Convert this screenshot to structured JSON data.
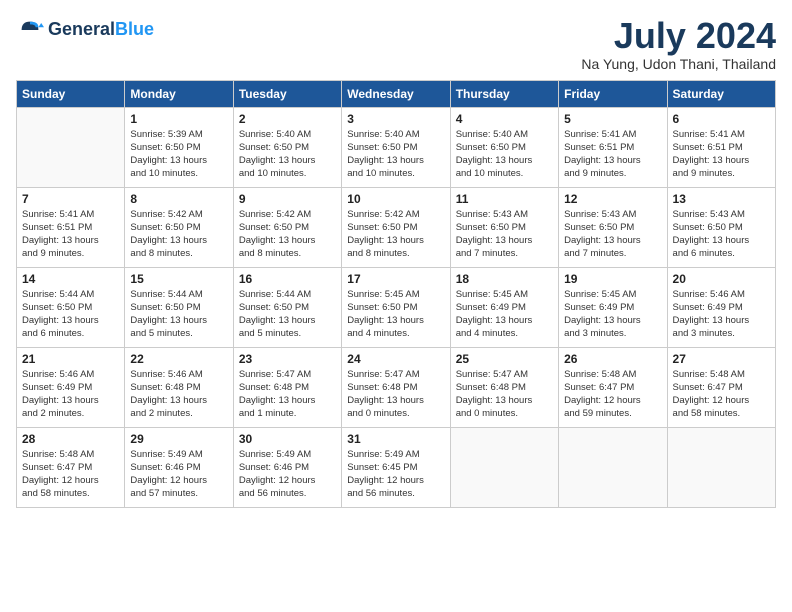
{
  "header": {
    "logo_line1": "General",
    "logo_line2": "Blue",
    "title": "July 2024",
    "subtitle": "Na Yung, Udon Thani, Thailand"
  },
  "weekdays": [
    "Sunday",
    "Monday",
    "Tuesday",
    "Wednesday",
    "Thursday",
    "Friday",
    "Saturday"
  ],
  "weeks": [
    [
      {
        "day": "",
        "info": ""
      },
      {
        "day": "1",
        "info": "Sunrise: 5:39 AM\nSunset: 6:50 PM\nDaylight: 13 hours\nand 10 minutes."
      },
      {
        "day": "2",
        "info": "Sunrise: 5:40 AM\nSunset: 6:50 PM\nDaylight: 13 hours\nand 10 minutes."
      },
      {
        "day": "3",
        "info": "Sunrise: 5:40 AM\nSunset: 6:50 PM\nDaylight: 13 hours\nand 10 minutes."
      },
      {
        "day": "4",
        "info": "Sunrise: 5:40 AM\nSunset: 6:50 PM\nDaylight: 13 hours\nand 10 minutes."
      },
      {
        "day": "5",
        "info": "Sunrise: 5:41 AM\nSunset: 6:51 PM\nDaylight: 13 hours\nand 9 minutes."
      },
      {
        "day": "6",
        "info": "Sunrise: 5:41 AM\nSunset: 6:51 PM\nDaylight: 13 hours\nand 9 minutes."
      }
    ],
    [
      {
        "day": "7",
        "info": "Sunrise: 5:41 AM\nSunset: 6:51 PM\nDaylight: 13 hours\nand 9 minutes."
      },
      {
        "day": "8",
        "info": "Sunrise: 5:42 AM\nSunset: 6:50 PM\nDaylight: 13 hours\nand 8 minutes."
      },
      {
        "day": "9",
        "info": "Sunrise: 5:42 AM\nSunset: 6:50 PM\nDaylight: 13 hours\nand 8 minutes."
      },
      {
        "day": "10",
        "info": "Sunrise: 5:42 AM\nSunset: 6:50 PM\nDaylight: 13 hours\nand 8 minutes."
      },
      {
        "day": "11",
        "info": "Sunrise: 5:43 AM\nSunset: 6:50 PM\nDaylight: 13 hours\nand 7 minutes."
      },
      {
        "day": "12",
        "info": "Sunrise: 5:43 AM\nSunset: 6:50 PM\nDaylight: 13 hours\nand 7 minutes."
      },
      {
        "day": "13",
        "info": "Sunrise: 5:43 AM\nSunset: 6:50 PM\nDaylight: 13 hours\nand 6 minutes."
      }
    ],
    [
      {
        "day": "14",
        "info": "Sunrise: 5:44 AM\nSunset: 6:50 PM\nDaylight: 13 hours\nand 6 minutes."
      },
      {
        "day": "15",
        "info": "Sunrise: 5:44 AM\nSunset: 6:50 PM\nDaylight: 13 hours\nand 5 minutes."
      },
      {
        "day": "16",
        "info": "Sunrise: 5:44 AM\nSunset: 6:50 PM\nDaylight: 13 hours\nand 5 minutes."
      },
      {
        "day": "17",
        "info": "Sunrise: 5:45 AM\nSunset: 6:50 PM\nDaylight: 13 hours\nand 4 minutes."
      },
      {
        "day": "18",
        "info": "Sunrise: 5:45 AM\nSunset: 6:49 PM\nDaylight: 13 hours\nand 4 minutes."
      },
      {
        "day": "19",
        "info": "Sunrise: 5:45 AM\nSunset: 6:49 PM\nDaylight: 13 hours\nand 3 minutes."
      },
      {
        "day": "20",
        "info": "Sunrise: 5:46 AM\nSunset: 6:49 PM\nDaylight: 13 hours\nand 3 minutes."
      }
    ],
    [
      {
        "day": "21",
        "info": "Sunrise: 5:46 AM\nSunset: 6:49 PM\nDaylight: 13 hours\nand 2 minutes."
      },
      {
        "day": "22",
        "info": "Sunrise: 5:46 AM\nSunset: 6:48 PM\nDaylight: 13 hours\nand 2 minutes."
      },
      {
        "day": "23",
        "info": "Sunrise: 5:47 AM\nSunset: 6:48 PM\nDaylight: 13 hours\nand 1 minute."
      },
      {
        "day": "24",
        "info": "Sunrise: 5:47 AM\nSunset: 6:48 PM\nDaylight: 13 hours\nand 0 minutes."
      },
      {
        "day": "25",
        "info": "Sunrise: 5:47 AM\nSunset: 6:48 PM\nDaylight: 13 hours\nand 0 minutes."
      },
      {
        "day": "26",
        "info": "Sunrise: 5:48 AM\nSunset: 6:47 PM\nDaylight: 12 hours\nand 59 minutes."
      },
      {
        "day": "27",
        "info": "Sunrise: 5:48 AM\nSunset: 6:47 PM\nDaylight: 12 hours\nand 58 minutes."
      }
    ],
    [
      {
        "day": "28",
        "info": "Sunrise: 5:48 AM\nSunset: 6:47 PM\nDaylight: 12 hours\nand 58 minutes."
      },
      {
        "day": "29",
        "info": "Sunrise: 5:49 AM\nSunset: 6:46 PM\nDaylight: 12 hours\nand 57 minutes."
      },
      {
        "day": "30",
        "info": "Sunrise: 5:49 AM\nSunset: 6:46 PM\nDaylight: 12 hours\nand 56 minutes."
      },
      {
        "day": "31",
        "info": "Sunrise: 5:49 AM\nSunset: 6:45 PM\nDaylight: 12 hours\nand 56 minutes."
      },
      {
        "day": "",
        "info": ""
      },
      {
        "day": "",
        "info": ""
      },
      {
        "day": "",
        "info": ""
      }
    ]
  ]
}
